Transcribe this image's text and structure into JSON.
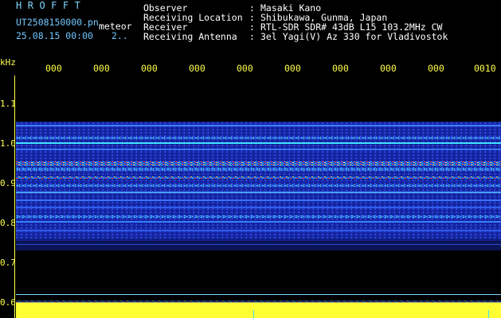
{
  "header": {
    "hrofft": "HROFFT",
    "filename": "UT2508150000.pn",
    "meteor_label": "meteor",
    "datetime": "25.08.15 00:00",
    "count": "2..",
    "observer_key": "Observer",
    "observer_val": "Masaki Kano",
    "location_key": "Receiving Location",
    "location_val": "Shibukawa, Gunma, Japan",
    "receiver_key": "Receiver",
    "receiver_val": "RTL-SDR SDR# 43dB L15 103.2MHz CW",
    "antenna_key": "Receiving Antenna",
    "antenna_val": "3el Yagi(V) Az 330 for Vladivostok",
    "sep": ":"
  },
  "axis": {
    "unit": "kHz",
    "y_ticks": [
      "1.1",
      "1.0",
      "0.9",
      "0.8",
      "0.7",
      "0.6"
    ],
    "x_ticks": [
      "000",
      "000",
      "000",
      "000",
      "000",
      "000",
      "000",
      "000",
      "000",
      "0010"
    ]
  },
  "colors": {
    "background": "#000000",
    "waterfall_base": "#1a28b0",
    "axis_text": "#ffff4a",
    "header_text": "#73c7ff",
    "strong_band": "#ff3020",
    "bottom_bar": "#ffff33"
  }
}
